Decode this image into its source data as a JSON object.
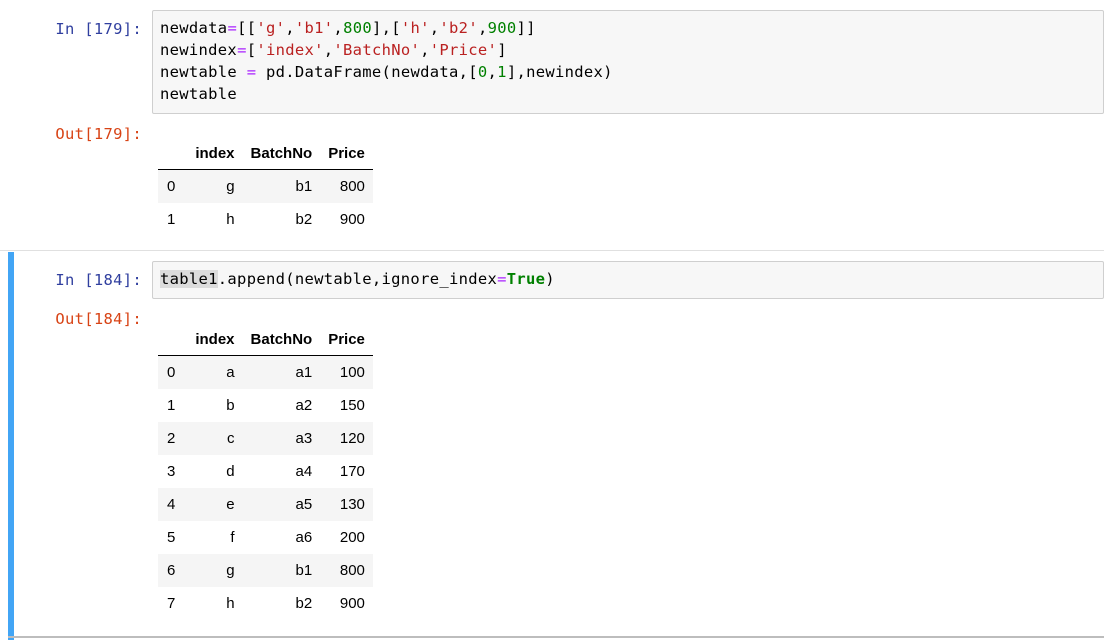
{
  "cells": [
    {
      "in_prompt": "In [179]:",
      "code_lines": [
        [
          {
            "t": "newdata"
          },
          {
            "t": "=",
            "c": "o"
          },
          {
            "t": "[["
          },
          {
            "t": "'g'",
            "c": "s"
          },
          {
            "t": ","
          },
          {
            "t": "'b1'",
            "c": "s"
          },
          {
            "t": ","
          },
          {
            "t": "800",
            "c": "n"
          },
          {
            "t": "],["
          },
          {
            "t": "'h'",
            "c": "s"
          },
          {
            "t": ","
          },
          {
            "t": "'b2'",
            "c": "s"
          },
          {
            "t": ","
          },
          {
            "t": "900",
            "c": "n"
          },
          {
            "t": "]]"
          }
        ],
        [
          {
            "t": "newindex"
          },
          {
            "t": "=",
            "c": "o"
          },
          {
            "t": "["
          },
          {
            "t": "'index'",
            "c": "s"
          },
          {
            "t": ","
          },
          {
            "t": "'BatchNo'",
            "c": "s"
          },
          {
            "t": ","
          },
          {
            "t": "'Price'",
            "c": "s"
          },
          {
            "t": "]"
          }
        ],
        [
          {
            "t": "newtable "
          },
          {
            "t": "=",
            "c": "o"
          },
          {
            "t": " pd"
          },
          {
            "t": "."
          },
          {
            "t": "DataFrame(newdata,["
          },
          {
            "t": "0",
            "c": "n"
          },
          {
            "t": ","
          },
          {
            "t": "1",
            "c": "n"
          },
          {
            "t": "],newindex)"
          }
        ],
        [
          {
            "t": "newtable"
          }
        ]
      ],
      "out_prompt": "Out[179]:",
      "table": {
        "columns": [
          "",
          "index",
          "BatchNo",
          "Price"
        ],
        "rows": [
          [
            "0",
            "g",
            "b1",
            "800"
          ],
          [
            "1",
            "h",
            "b2",
            "900"
          ]
        ]
      }
    },
    {
      "in_prompt": "In [184]:",
      "code_lines": [
        [
          {
            "t": "table1",
            "c": "hl"
          },
          {
            "t": ".append(newtable,ignore_index"
          },
          {
            "t": "=",
            "c": "o"
          },
          {
            "t": "True",
            "c": "k"
          },
          {
            "t": ")"
          }
        ]
      ],
      "out_prompt": "Out[184]:",
      "table": {
        "columns": [
          "",
          "index",
          "BatchNo",
          "Price"
        ],
        "rows": [
          [
            "0",
            "a",
            "a1",
            "100"
          ],
          [
            "1",
            "b",
            "a2",
            "150"
          ],
          [
            "2",
            "c",
            "a3",
            "120"
          ],
          [
            "3",
            "d",
            "a4",
            "170"
          ],
          [
            "4",
            "e",
            "a5",
            "130"
          ],
          [
            "5",
            "f",
            "a6",
            "200"
          ],
          [
            "6",
            "g",
            "b1",
            "800"
          ],
          [
            "7",
            "h",
            "b2",
            "900"
          ]
        ]
      }
    }
  ]
}
